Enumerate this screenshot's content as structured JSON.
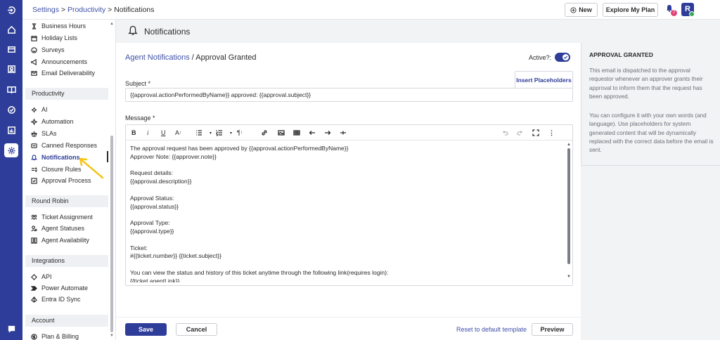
{
  "breadcrumb": {
    "settings": "Settings",
    "sep1": ">",
    "productivity": "Productivity",
    "sep2": ">",
    "current": "Notifications"
  },
  "topbar": {
    "new_label": "New",
    "plan_label": "Explore My Plan",
    "bell_badge": "7",
    "avatar_initial": "R"
  },
  "rail": {
    "icons": [
      "logo-icon",
      "home-icon",
      "tickets-icon",
      "contacts-icon",
      "knowledge-base-icon",
      "tasks-icon",
      "reports-icon",
      "settings-icon",
      "chat-icon"
    ],
    "active": "settings-icon"
  },
  "sidebar": {
    "group_top": [
      "Business Hours",
      "Holiday Lists",
      "Surveys",
      "Announcements",
      "Email Deliverability"
    ],
    "section_productivity": "Productivity",
    "productivity_items": [
      "AI",
      "Automation",
      "SLAs",
      "Canned Responses",
      "Notifications",
      "Closure Rules",
      "Approval Process"
    ],
    "section_round_robin": "Round Robin",
    "round_robin_items": [
      "Ticket Assignment",
      "Agent Statuses",
      "Agent Availability"
    ],
    "section_integrations": "Integrations",
    "integrations_items": [
      "API",
      "Power Automate",
      "Entra ID Sync"
    ],
    "section_account": "Account",
    "account_items": [
      "Plan & Billing"
    ],
    "active_item": "Notifications"
  },
  "page": {
    "title": "Notifications"
  },
  "panel": {
    "title_link": "Agent Notifications",
    "title_sep": "/",
    "title_current": "Approval Granted",
    "active_label": "Active?:",
    "active": true,
    "subject_label": "Subject *",
    "insert_placeholders": "Insert Placeholders",
    "subject_value": "{{approval.actionPerformedByName}} approved: {{approval.subject}}",
    "message_label": "Message *",
    "message_lines": [
      "The approval request has been approved by {{approval.actionPerformedByName}}",
      "Approver Note: {{approver.note}}",
      "",
      "Request details:",
      "{{approval.description}}",
      "",
      "Approval Status:",
      "{{approval.status}}",
      "",
      "Approval Type:",
      "{{approval.type}}",
      "",
      "Ticket:",
      "#{{ticket.number}} {{ticket.subject}}",
      "",
      "You can view the status and history of this ticket anytime through the following link(requires login):",
      "{{ticket.agentLink}}"
    ],
    "save": "Save",
    "cancel": "Cancel",
    "reset": "Reset to default template",
    "preview": "Preview"
  },
  "info": {
    "title": "APPROVAL GRANTED",
    "p1": "This email is dispatched to the approval requestor whenever an approver grants their approval to inform them that the request has been approved.",
    "p2": "You can configure it with your own words (and language). Use placeholders for system generated content that will be dynamically replaced with the correct data before the email is sent."
  },
  "colors": {
    "brand": "#2e3d99",
    "link": "#3f51a8",
    "badge": "#e0457b",
    "online": "#3aa856",
    "annotation": "#f5c518"
  }
}
